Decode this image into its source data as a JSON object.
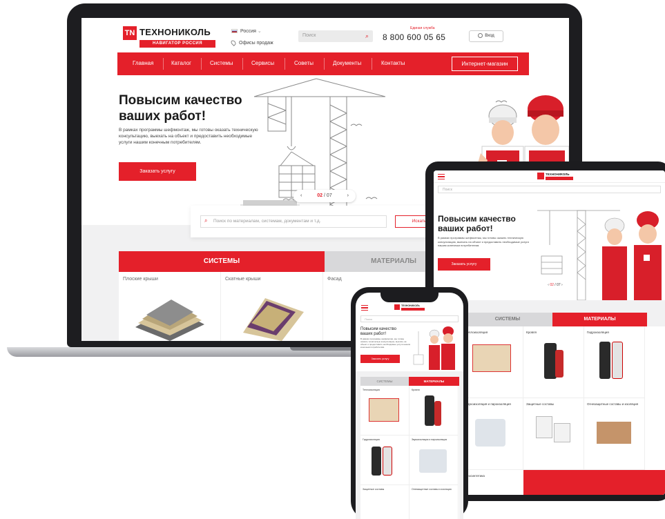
{
  "desktop": {
    "logo": {
      "mark": "TN",
      "name": "ТЕХНОНИКОЛЬ",
      "subtitle": "НАВИГАТОР РОССИЯ"
    },
    "region": {
      "label": "Россия",
      "dropdown_icon": "chevron-down-icon"
    },
    "offices_label": "Офисы продаж",
    "search_placeholder": "Поиск",
    "phone_note": "Единая служба",
    "phone_number": "8 800 600 05 65",
    "login_label": "Вход",
    "nav": [
      "Главная",
      "Каталог",
      "Системы",
      "Сервисы",
      "Советы",
      "Документы",
      "Контакты"
    ],
    "shop_button": "Интернет-магазин",
    "hero": {
      "title": "Повысим качество ваших работ!",
      "text": "В рамках программы шефмонтаж, мы готовы оказать техническую консультацию, выехать на объект и предоставить необходимые услуги нашим конечным потребителям.",
      "button": "Заказать услугу"
    },
    "slider": {
      "current": "02",
      "separator": " / ",
      "total": "07"
    },
    "catalog_search": {
      "placeholder": "Поиск по материалам, системам, документам и т.д.",
      "button": "Искать"
    },
    "tabs": {
      "systems": "СИСТЕМЫ",
      "materials": "МАТЕРИАЛЫ"
    },
    "cards": [
      "Плоские крыши",
      "Скатные крыши",
      "Фасад"
    ]
  },
  "tablet": {
    "search_placeholder": "Поиск",
    "hero": {
      "title": "Повысим качество ваших работ!",
      "text": "В рамках программы шефмонтаж, мы готовы оказать техническую консультацию, выехать на объект и предоставить необходимые услуги нашим конечным потребителям.",
      "button": "Заказать услугу"
    },
    "slider": {
      "current": "02",
      "separator": " / ",
      "total": "07"
    },
    "tabs": {
      "systems": "СИСТЕМЫ",
      "materials": "МАТЕРИАЛЫ"
    },
    "cells": [
      {
        "title": "Теплоизоляция",
        "price": ""
      },
      {
        "title": "Кровля",
        "price": ""
      },
      {
        "title": "Гидроизоляция",
        "price": ""
      },
      {
        "title": "Звукоизоляция и пароизоляция",
        "price": ""
      },
      {
        "title": "Защитные составы",
        "price": ""
      },
      {
        "title": "Огнезащитные составы и изоляция",
        "price": ""
      }
    ],
    "footer_label": "Геосинтетика"
  },
  "phone": {
    "search_placeholder": "Поиск",
    "hero": {
      "title": "Повысим качество ваших работ!",
      "text": "В рамках программы шефмонтаж, мы готовы оказать техническую консультацию, выехать на объект и предоставить необходимые услуги нашим конечным потребителям.",
      "button": "Заказать услугу"
    },
    "tabs": {
      "systems": "СИСТЕМЫ",
      "materials": "МАТЕРИАЛЫ"
    },
    "cells": [
      {
        "title": "Теплоизоляция",
        "price": ""
      },
      {
        "title": "Кровля",
        "price": ""
      },
      {
        "title": "Гидроизоляция",
        "price": ""
      },
      {
        "title": "Звукоизоляция и пароизоляция",
        "price": ""
      },
      {
        "title": "Защитные составы",
        "price": ""
      },
      {
        "title": "Огнезащитные составы и изоляция",
        "price": ""
      }
    ]
  },
  "colors": {
    "brand_red": "#e4202a",
    "device_frame": "#1d1d20",
    "panel_gray": "#f1f1f2"
  }
}
